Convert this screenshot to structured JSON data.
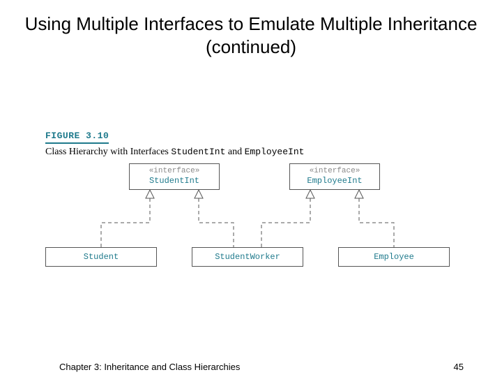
{
  "title": "Using Multiple Interfaces to Emulate Multiple Inheritance (continued)",
  "figure": {
    "label": "FIGURE 3.10",
    "caption_prefix": "Class Hierarchy with Interfaces ",
    "caption_iface1": "StudentInt",
    "caption_and": " and ",
    "caption_iface2": "EmployeeInt"
  },
  "diagram": {
    "stereotype": "«interface»",
    "iface_student": "StudentInt",
    "iface_employee": "EmployeeInt",
    "cls_student": "Student",
    "cls_studentworker": "StudentWorker",
    "cls_employee": "Employee"
  },
  "footer": {
    "chapter": "Chapter 3: Inheritance and Class Hierarchies",
    "page": "45"
  }
}
